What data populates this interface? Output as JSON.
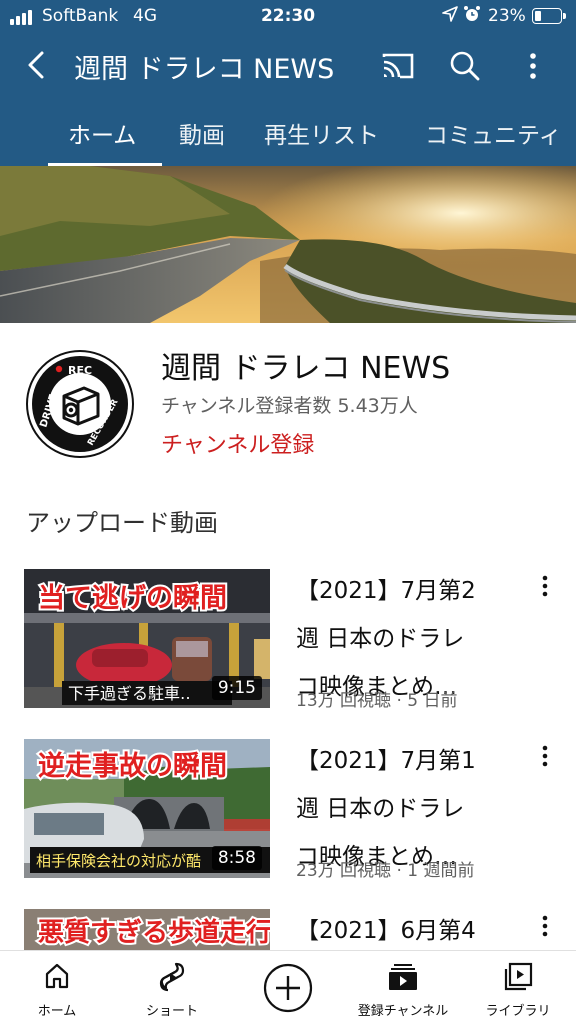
{
  "status_bar": {
    "carrier": "SoftBank",
    "network": "4G",
    "time": "22:30",
    "battery_percent_label": "23%",
    "battery_level": 0.23,
    "icons": [
      "signal-bars-icon",
      "location-arrow-icon",
      "alarm-clock-icon",
      "battery-icon"
    ]
  },
  "app_bar": {
    "title": "週間 ドラレコ NEWS",
    "icons": [
      "back-chevron-icon",
      "cast-icon",
      "search-icon",
      "more-vertical-icon"
    ]
  },
  "tabs": [
    {
      "label": "ホーム",
      "active": true
    },
    {
      "label": "動画",
      "active": false
    },
    {
      "label": "再生リスト",
      "active": false
    },
    {
      "label": "コミュニティ",
      "active": false
    }
  ],
  "channel": {
    "name": "週間 ドラレコ NEWS",
    "subscribers": "チャンネル登録者数 5.43万人",
    "subscribe_label": "チャンネル登録",
    "avatar_text_top": "REC",
    "avatar_text_left": "DRIVE",
    "avatar_text_right": "RECORDER"
  },
  "section_title": "アップロード動画",
  "videos": [
    {
      "thumb_headline": "当て逃げの瞬間",
      "thumb_caption": "下手過ぎる駐車‥",
      "duration": "9:15",
      "title_lines": [
        "【2021】7月第2",
        "週 日本のドラレ",
        "コ映像まとめ…"
      ],
      "meta": "13万 回視聴 · 5 日前"
    },
    {
      "thumb_headline": "逆走事故の瞬間",
      "thumb_caption": "相手保険会社の対応が酷",
      "duration": "8:58",
      "title_lines": [
        "【2021】7月第1",
        "週 日本のドラレ",
        "コ映像まとめ…"
      ],
      "meta": "23万 回視聴 · 1 週間前"
    },
    {
      "thumb_headline": "悪質すぎる歩道走行",
      "thumb_caption": "",
      "duration": "",
      "title_lines": [
        "【2021】6月第4",
        "",
        ""
      ],
      "meta": ""
    }
  ],
  "bottom_nav": [
    {
      "label": "ホーム",
      "icon": "home-icon"
    },
    {
      "label": "ショート",
      "icon": "shorts-icon"
    },
    {
      "label": "",
      "icon": "create-plus-icon"
    },
    {
      "label": "登録チャンネル",
      "icon": "subscriptions-icon"
    },
    {
      "label": "ライブラリ",
      "icon": "library-icon"
    }
  ],
  "colors": {
    "header_bg": "#235a85",
    "subscribe_red": "#cc1f1f",
    "thumb_headline_red": "#e02020"
  }
}
